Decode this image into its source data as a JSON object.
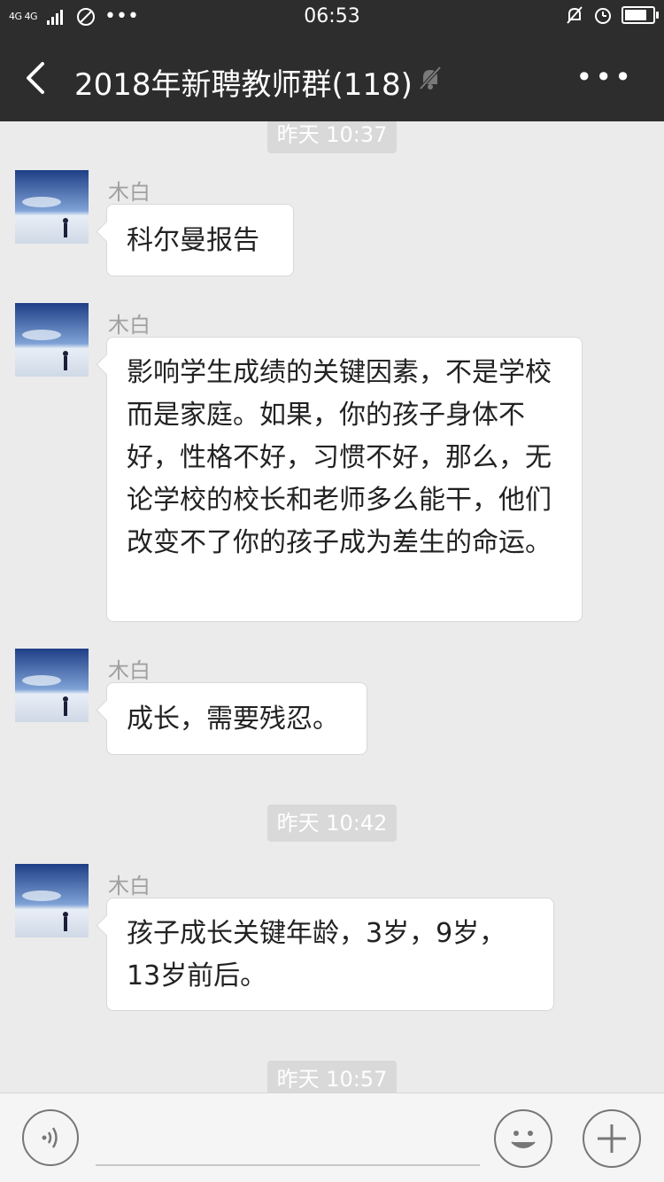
{
  "status_bar": {
    "network": "4G 4G",
    "time": "06:53",
    "battery_level": 0.85
  },
  "header": {
    "title": "2018年新聘教师群(118)",
    "back_icon": "chevron-left-icon",
    "mute_icon": "bell-off-icon",
    "more_icon": "more-horizontal-icon"
  },
  "chat": {
    "timestamps": [
      "昨天 10:37",
      "昨天 10:42",
      "昨天 10:57"
    ],
    "messages": [
      {
        "sender": "木白",
        "text": "科尔曼报告"
      },
      {
        "sender": "木白",
        "text": "影响学生成绩的关键因素，不是学校而是家庭。如果，你的孩子身体不好，性格不好，习惯不好，那么，无论学校的校长和老师多么能干，他们改变不了你的孩子成为差生的命运。"
      },
      {
        "sender": "木白",
        "text": "成长，需要残忍。"
      },
      {
        "sender": "木白",
        "text": "孩子成长关键年龄，3岁，9岁，13岁前后。"
      }
    ]
  },
  "input_bar": {
    "voice_icon": "voice-icon",
    "emoji_icon": "emoji-icon",
    "plus_icon": "plus-icon"
  }
}
